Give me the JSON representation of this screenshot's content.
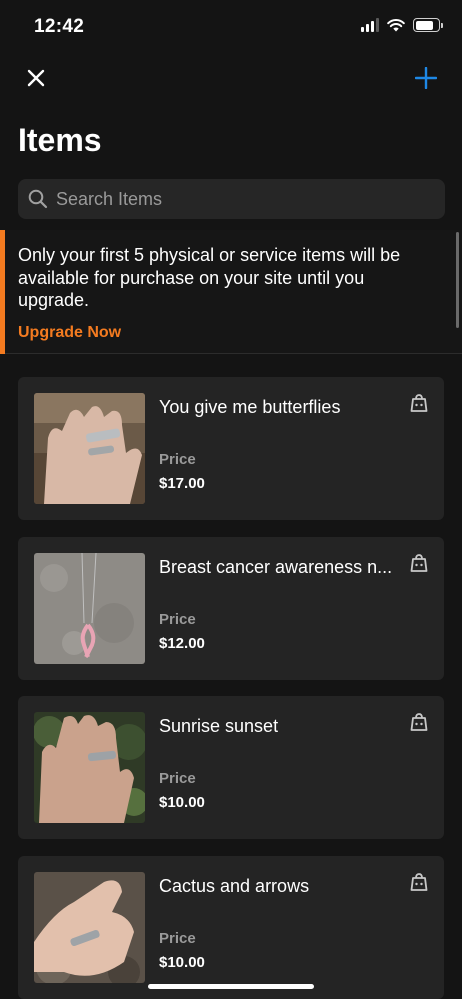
{
  "status_bar": {
    "time": "12:42"
  },
  "header": {
    "title": "Items"
  },
  "search": {
    "placeholder": "Search Items"
  },
  "banner": {
    "message": "Only your first 5 physical or service items will be available for purchase on your site until you upgrade.",
    "link_label": "Upgrade Now",
    "accent_color": "#f47b20"
  },
  "items": [
    {
      "name": "You give me butterflies",
      "price_label": "Price",
      "price": "$17.00",
      "icon": "shop-icon"
    },
    {
      "name": "Breast cancer awareness n...",
      "price_label": "Price",
      "price": "$12.00",
      "icon": "shop-icon"
    },
    {
      "name": "Sunrise sunset",
      "price_label": "Price",
      "price": "$10.00",
      "icon": "shop-icon"
    },
    {
      "name": "Cactus and arrows",
      "price_label": "Price",
      "price": "$10.00",
      "icon": "shop-icon"
    }
  ],
  "colors": {
    "background": "#141414",
    "card": "#242424",
    "accent_blue": "#1e88e5",
    "accent_orange": "#f47b20"
  }
}
